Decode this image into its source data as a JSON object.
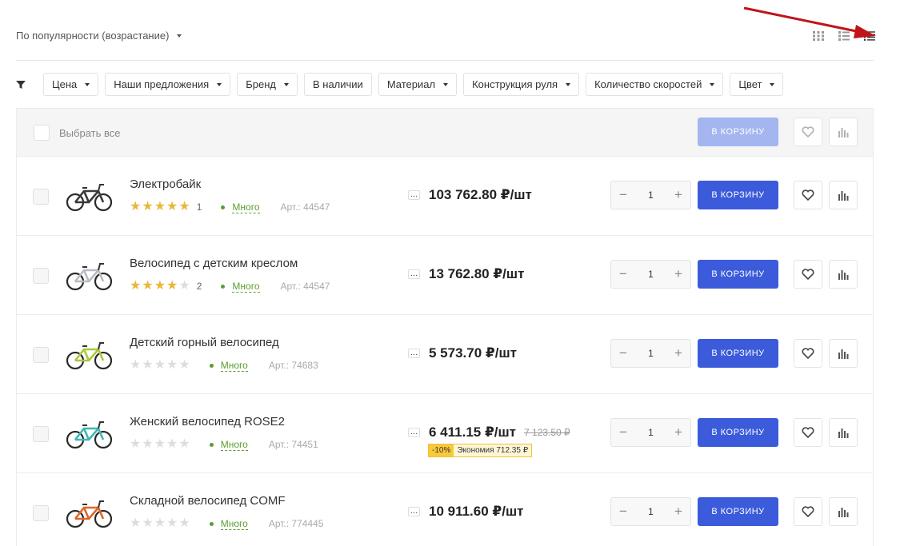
{
  "sort": {
    "label": "По популярности (возрастание)"
  },
  "colors": {
    "accent": "#3b5bdb",
    "accent_disabled": "#a4b5f0",
    "star": "#e8b83a",
    "stock": "#5a9e2f",
    "arrow": "#c0141a"
  },
  "filters": [
    {
      "label": "Цена",
      "dropdown": true
    },
    {
      "label": "Наши предложения",
      "dropdown": true
    },
    {
      "label": "Бренд",
      "dropdown": true
    },
    {
      "label": "В наличии",
      "dropdown": false
    },
    {
      "label": "Материал",
      "dropdown": true
    },
    {
      "label": "Конструкция руля",
      "dropdown": true
    },
    {
      "label": "Количество скоростей",
      "dropdown": true
    },
    {
      "label": "Цвет",
      "dropdown": true
    }
  ],
  "header": {
    "select_all": "Выбрать все",
    "cart_label": "В КОРЗИНУ"
  },
  "products": [
    {
      "name": "Электробайк",
      "rating": 5,
      "reviews": "1",
      "stock": "Много",
      "article": "Арт.: 44547",
      "price": "103 762.80 ₽/шт",
      "old_price": "",
      "discount": "",
      "saving": "",
      "qty": "1",
      "cart_label": "В КОРЗИНУ",
      "frame_color": "#3a3a3a"
    },
    {
      "name": "Велосипед с детским креслом",
      "rating": 4,
      "reviews": "2",
      "stock": "Много",
      "article": "Арт.: 44547",
      "price": "13 762.80 ₽/шт",
      "old_price": "",
      "discount": "",
      "saving": "",
      "qty": "1",
      "cart_label": "В КОРЗИНУ",
      "frame_color": "#b8bcc4"
    },
    {
      "name": "Детский горный велосипед",
      "rating": 0,
      "reviews": "",
      "stock": "Много",
      "article": "Арт.: 74683",
      "price": "5 573.70 ₽/шт",
      "old_price": "",
      "discount": "",
      "saving": "",
      "qty": "1",
      "cart_label": "В КОРЗИНУ",
      "frame_color": "#a8c93a"
    },
    {
      "name": "Женский велосипед ROSE2",
      "rating": 0,
      "reviews": "",
      "stock": "Много",
      "article": "Арт.: 74451",
      "price": "6 411.15 ₽/шт",
      "old_price": "7 123.50 ₽",
      "discount": "-10%",
      "saving": "Экономия 712.35 ₽",
      "qty": "1",
      "cart_label": "В КОРЗИНУ",
      "frame_color": "#3fb7b2"
    },
    {
      "name": "Складной велосипед COMF",
      "rating": 0,
      "reviews": "",
      "stock": "Много",
      "article": "Арт.: 774445",
      "price": "10 911.60 ₽/шт",
      "old_price": "",
      "discount": "",
      "saving": "",
      "qty": "1",
      "cart_label": "В КОРЗИНУ",
      "frame_color": "#e0662a"
    }
  ]
}
